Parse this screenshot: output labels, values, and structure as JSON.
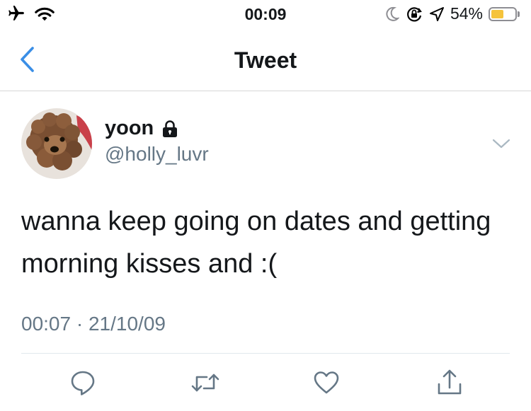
{
  "status_bar": {
    "time": "00:09",
    "battery_percent": "54%",
    "battery_level": 0.54,
    "battery_color": "#f5c33b",
    "icons": [
      "airplane-icon",
      "wifi-icon",
      "moon-icon",
      "orientation-lock-icon",
      "location-icon",
      "battery-icon"
    ]
  },
  "nav": {
    "title": "Tweet",
    "back_icon": "chevron-left-icon",
    "accent_color": "#3a8ee6"
  },
  "tweet": {
    "display_name": "yoon",
    "protected_icon": "lock-icon",
    "handle": "@holly_luvr",
    "text": "wanna keep going on dates and getting morning kisses and :(",
    "time": "00:07",
    "separator": "·",
    "date": "21/10/09",
    "menu_icon": "chevron-down-icon"
  },
  "actions": [
    {
      "icon": "reply-icon"
    },
    {
      "icon": "retweet-icon"
    },
    {
      "icon": "like-icon"
    },
    {
      "icon": "share-icon"
    }
  ]
}
